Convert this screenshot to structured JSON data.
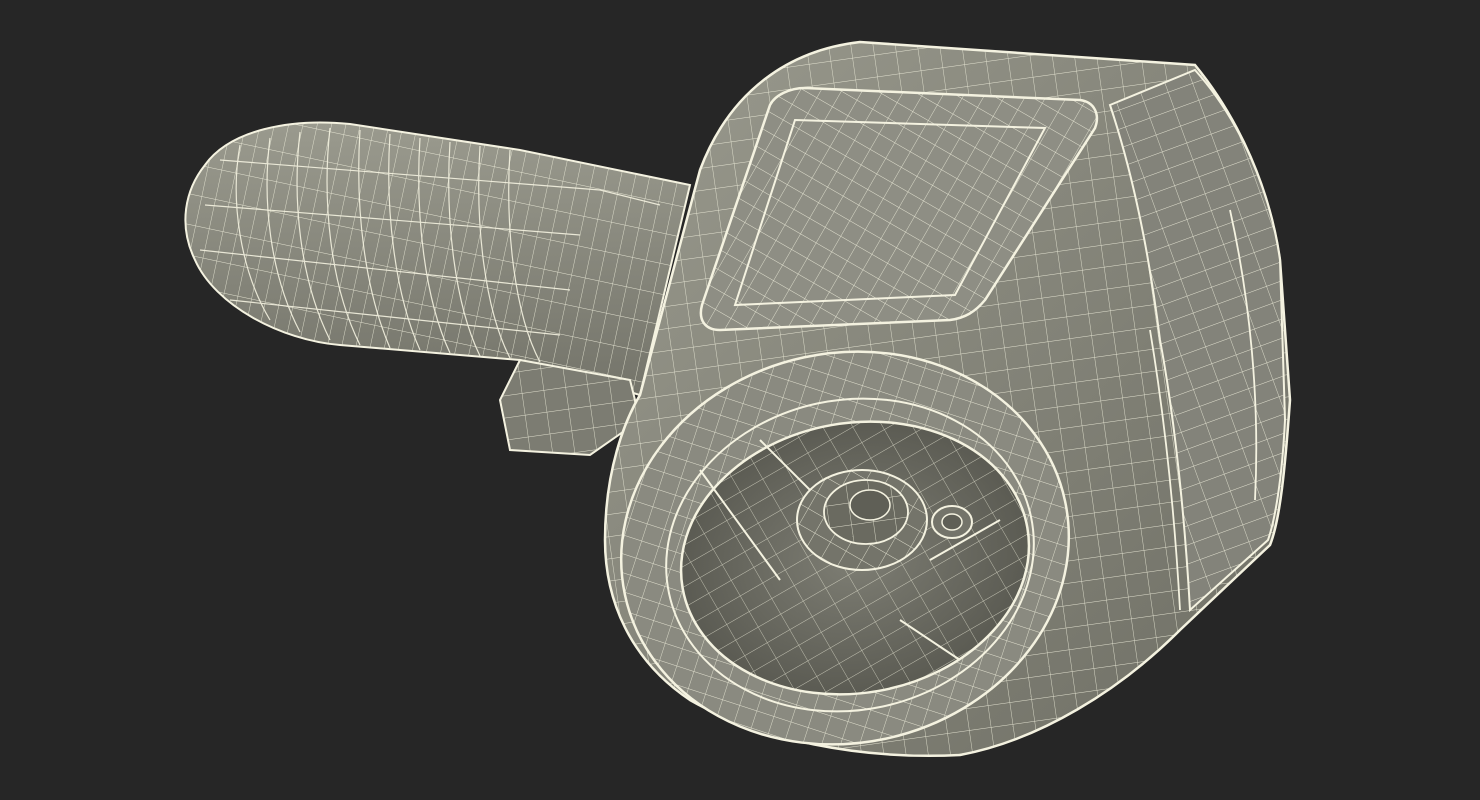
{
  "scene": {
    "subject": "wireframe-render",
    "colors": {
      "background": "#262626",
      "surface": "#8b8b80",
      "surface_light": "#a2a296",
      "surface_dark": "#5f5f56",
      "wire": "#f4f2e0"
    }
  }
}
